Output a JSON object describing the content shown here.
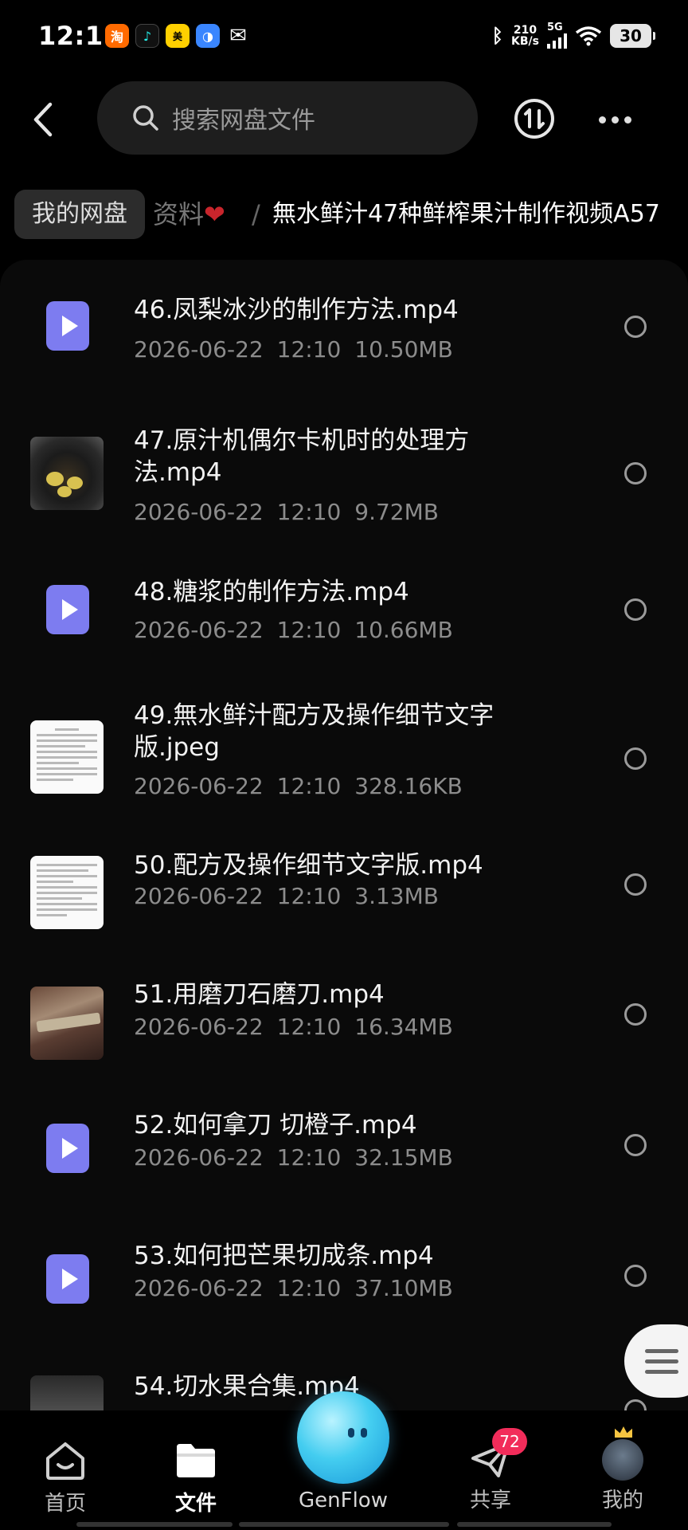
{
  "status_bar": {
    "time": "12:11",
    "net_speed_value": "210",
    "net_speed_unit": "KB/s",
    "network": "5G",
    "battery": "30",
    "app_icons": [
      "taobao-icon",
      "tiktok-icon",
      "meituan-icon",
      "browser-icon",
      "wechat-icon"
    ]
  },
  "header": {
    "search_placeholder": "搜索网盘文件"
  },
  "breadcrumb": {
    "home": "我的网盘",
    "faded": "资料",
    "separator": "/",
    "current": "無水鲜汁47种鲜榨果汁制作视频A57"
  },
  "files": [
    {
      "name": "46.凤梨冰沙的制作方法.mp4",
      "date": "2026-06-22",
      "time": "12:10",
      "size": "10.50MB",
      "thumb": "video"
    },
    {
      "name": "47.原汁机偶尔卡机时的处理方法.mp4",
      "date": "2026-06-22",
      "time": "12:10",
      "size": "9.72MB",
      "thumb": "juicer"
    },
    {
      "name": "48.糖浆的制作方法.mp4",
      "date": "2026-06-22",
      "time": "12:10",
      "size": "10.66MB",
      "thumb": "video"
    },
    {
      "name": "49.無水鲜汁配方及操作细节文字版.jpeg",
      "date": "2026-06-22",
      "time": "12:10",
      "size": "328.16KB",
      "thumb": "doc"
    },
    {
      "name": "50.配方及操作细节文字版.mp4",
      "date": "2026-06-22",
      "time": "12:10",
      "size": "3.13MB",
      "thumb": "doc"
    },
    {
      "name": "51.用磨刀石磨刀.mp4",
      "date": "2026-06-22",
      "time": "12:10",
      "size": "16.34MB",
      "thumb": "knife"
    },
    {
      "name": "52.如何拿刀 切橙子.mp4",
      "date": "2026-06-22",
      "time": "12:10",
      "size": "32.15MB",
      "thumb": "video"
    },
    {
      "name": "53.如何把芒果切成条.mp4",
      "date": "2026-06-22",
      "time": "12:10",
      "size": "37.10MB",
      "thumb": "video"
    },
    {
      "name": "54.切水果合集.mp4",
      "date": "",
      "time": "",
      "size": "",
      "thumb": "fruit"
    }
  ],
  "bottom_nav": {
    "home": "首页",
    "files": "文件",
    "genflow": "GenFlow",
    "share": "共享",
    "share_badge": "72",
    "mine": "我的"
  },
  "colors": {
    "background": "#000000",
    "panel": "#0a0a0a",
    "video_icon": "#7d7cf0",
    "badge": "#f22c5a",
    "heart": "#c8252c"
  }
}
